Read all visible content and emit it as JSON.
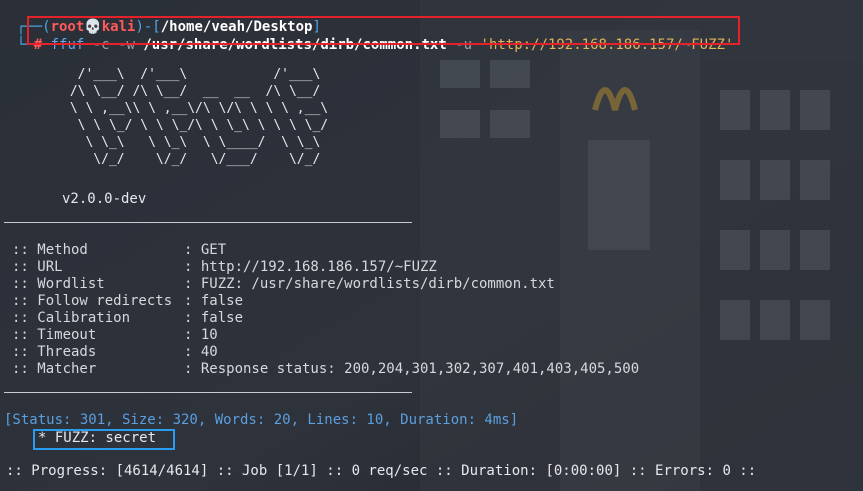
{
  "prompt": {
    "top_frame": "┌──(",
    "user": "root",
    "skull": "💀",
    "host": "kali",
    "sep": ")-[",
    "cwd": "/home/veah/Desktop",
    "close": "]",
    "bottom_frame": "└─",
    "hash": "#"
  },
  "command": {
    "bin": "ffuf",
    "flag_c": "-c",
    "flag_w": "-w",
    "wordlist": "/usr/share/wordlists/dirb/common.txt",
    "flag_u": "-u",
    "url": "'http://192.168.186.157/~FUZZ'"
  },
  "banner_art": "  /'___\\  /'___\\           /'___\\\n /\\ \\__/ /\\ \\__/  __  __  /\\ \\__/\n \\ \\ ,__\\\\ \\ ,__\\/\\ \\/\\ \\ \\ \\ ,__\\\n  \\ \\ \\_/ \\ \\ \\_/\\ \\ \\_\\ \\ \\ \\ \\_/\n   \\ \\_\\   \\ \\_\\  \\ \\____/  \\ \\_\\\n    \\/_/    \\/_/   \\/___/    \\/_/",
  "version": "v2.0.0-dev",
  "options": [
    {
      "key": ":: Method",
      "value": ": GET"
    },
    {
      "key": ":: URL",
      "value": ": http://192.168.186.157/~FUZZ"
    },
    {
      "key": ":: Wordlist",
      "value": ": FUZZ: /usr/share/wordlists/dirb/common.txt"
    },
    {
      "key": ":: Follow redirects",
      "value": ": false"
    },
    {
      "key": ":: Calibration",
      "value": ": false"
    },
    {
      "key": ":: Timeout",
      "value": ": 10"
    },
    {
      "key": ":: Threads",
      "value": ": 40"
    },
    {
      "key": ":: Matcher",
      "value": ": Response status: 200,204,301,302,307,401,403,405,500"
    }
  ],
  "result": {
    "status_line": "[Status: 301, Size: 320, Words: 20, Lines: 10, Duration: 4ms]",
    "fuzz_line": "* FUZZ: secret"
  },
  "progress_line": ":: Progress: [4614/4614] :: Job [1/1] :: 0 req/sec :: Duration: [0:00:00] :: Errors: 0 ::",
  "colors": {
    "background": "#262a33",
    "prompt_frame": "#4aa7e8",
    "user": "#ff5a5a",
    "url_string": "#e3b35e",
    "status": "#5b9fde",
    "highlight_red": "#e5212a",
    "highlight_blue": "#2a9cf0"
  }
}
